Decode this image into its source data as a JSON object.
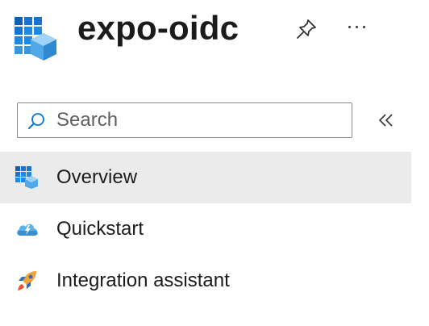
{
  "header": {
    "title": "expo-oidc",
    "app_icon": "app-registration-icon",
    "pin_icon": "pin-icon",
    "more_icon": "more-icon"
  },
  "search": {
    "placeholder": "Search",
    "value": "",
    "icon": "search-icon"
  },
  "collapse": {
    "icon": "collapse-chevrons-icon"
  },
  "nav": {
    "items": [
      {
        "label": "Overview",
        "icon": "overview-grid-icon",
        "selected": true
      },
      {
        "label": "Quickstart",
        "icon": "quickstart-cloud-icon",
        "selected": false
      },
      {
        "label": "Integration assistant",
        "icon": "rocket-icon",
        "selected": false
      }
    ]
  },
  "colors": {
    "selected_bg": "#ebebeb",
    "accent_blue": "#0078d4",
    "text": "#1b1b1b"
  }
}
